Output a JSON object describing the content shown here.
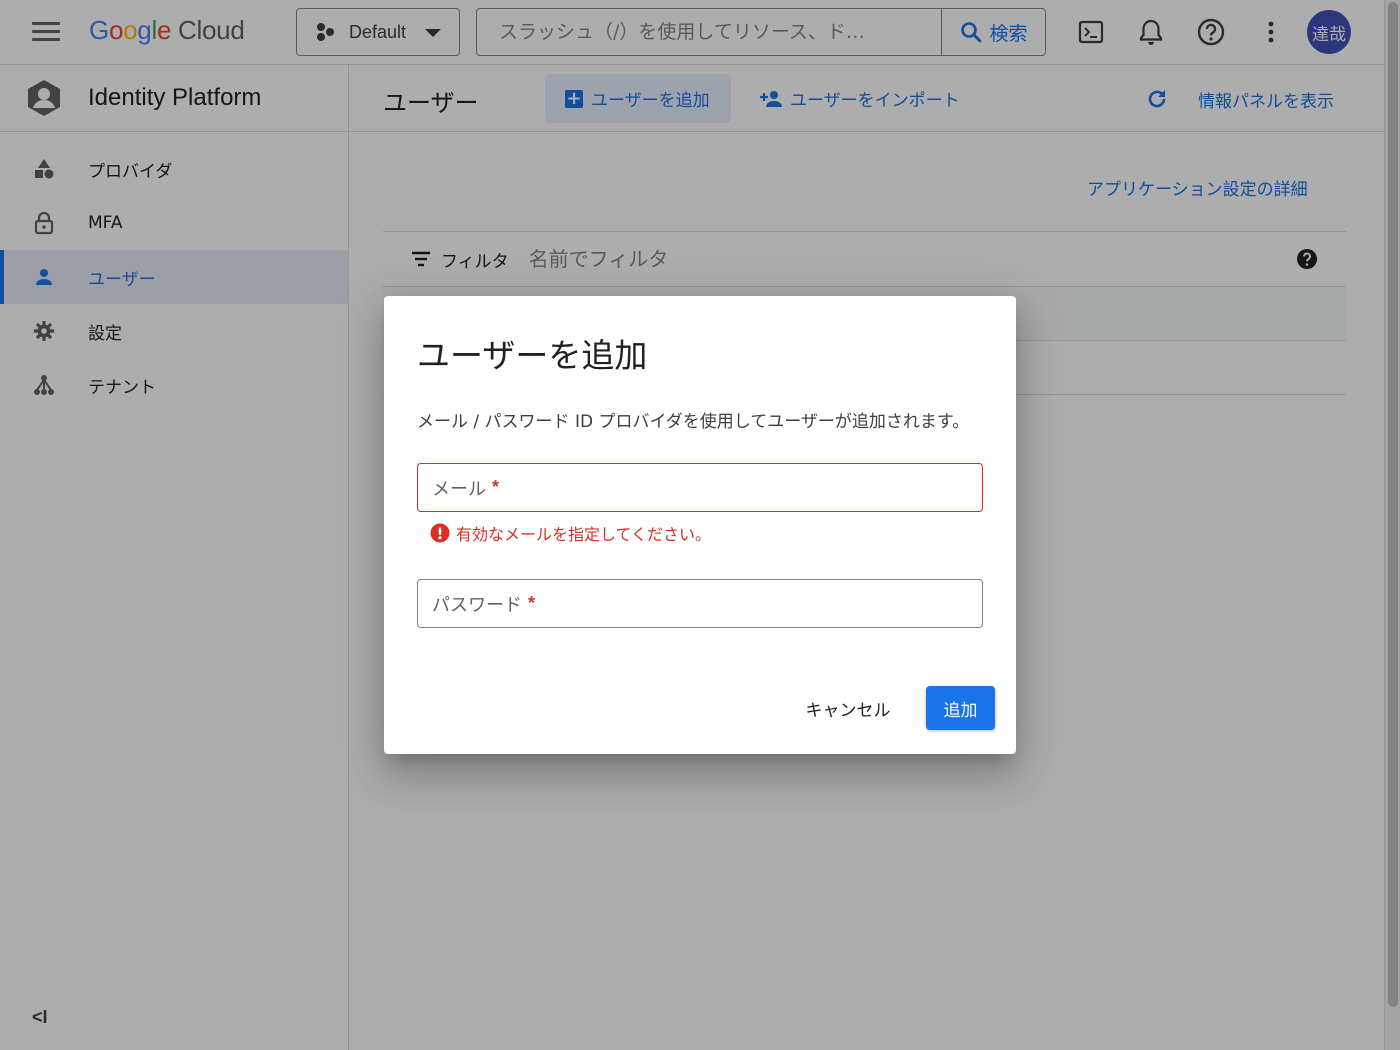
{
  "topbar": {
    "brand_google": "Google",
    "brand_cloud": "Cloud",
    "project": "Default",
    "search_placeholder": "スラッシュ（/）を使用してリソース、ド…",
    "search_button": "検索",
    "avatar_text": "達哉"
  },
  "sidebar": {
    "product_title": "Identity Platform",
    "items": [
      {
        "label": "プロバイダ",
        "icon": "shapes-icon"
      },
      {
        "label": "MFA",
        "icon": "lock-icon"
      },
      {
        "label": "ユーザー",
        "icon": "person-icon",
        "active": true
      },
      {
        "label": "設定",
        "icon": "gear-icon"
      },
      {
        "label": "テナント",
        "icon": "tenant-icon"
      }
    ],
    "collapse_label": "<I"
  },
  "main": {
    "page_title": "ユーザー",
    "add_user": "ユーザーを追加",
    "import_users": "ユーザーをインポート",
    "info_panel": "情報パネルを表示",
    "app_settings_link": "アプリケーション設定の詳細",
    "filter_label": "フィルタ",
    "filter_placeholder": "名前でフィルタ"
  },
  "dialog": {
    "title": "ユーザーを追加",
    "description": "メール / パスワード ID プロバイダを使用してユーザーが追加されます。",
    "email_label": "メール",
    "password_label": "パスワード",
    "required_mark": "*",
    "email_error": "有効なメールを指定してください。",
    "cancel": "キャンセル",
    "submit": "追加"
  },
  "colors": {
    "accent": "#1a73e8",
    "error": "#d93025",
    "avatar_bg": "#3f51b5"
  }
}
